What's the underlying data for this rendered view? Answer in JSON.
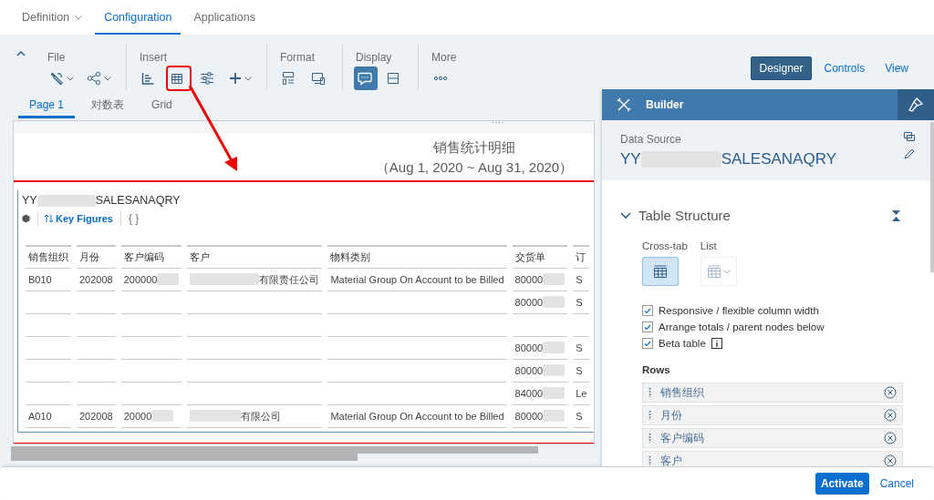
{
  "top_tabs": [
    {
      "label": "Definition",
      "selected": false,
      "menu": true
    },
    {
      "label": "Configuration",
      "selected": true,
      "menu": false
    },
    {
      "label": "Applications",
      "selected": false,
      "menu": false
    }
  ],
  "toolbar": {
    "groups": [
      {
        "label": "File",
        "tools": [
          {
            "kind": "wrench",
            "menu": true,
            "active": false,
            "annotated": false
          },
          {
            "kind": "share",
            "menu": true,
            "active": false,
            "annotated": false
          }
        ]
      },
      {
        "label": "Insert",
        "tools": [
          {
            "kind": "chart",
            "menu": false,
            "active": false,
            "annotated": false
          },
          {
            "kind": "table",
            "menu": false,
            "active": false,
            "annotated": true
          },
          {
            "kind": "sliders",
            "menu": false,
            "active": false,
            "annotated": false
          },
          {
            "kind": "plus",
            "menu": true,
            "active": false,
            "annotated": false
          }
        ]
      },
      {
        "label": "Format",
        "tools": [
          {
            "kind": "form",
            "menu": false,
            "active": false,
            "annotated": false
          },
          {
            "kind": "devices",
            "menu": false,
            "active": false,
            "annotated": false
          }
        ]
      },
      {
        "label": "Display",
        "tools": [
          {
            "kind": "comment",
            "menu": false,
            "active": true,
            "annotated": false
          },
          {
            "kind": "panels",
            "menu": false,
            "active": false,
            "annotated": false
          }
        ]
      },
      {
        "label": "More",
        "tools": [
          {
            "kind": "dots",
            "menu": false,
            "active": false,
            "annotated": false
          }
        ]
      }
    ]
  },
  "view_switch": [
    {
      "label": "Designer",
      "selected": true
    },
    {
      "label": "Controls",
      "selected": false
    },
    {
      "label": "View",
      "selected": false
    }
  ],
  "page_tabs": [
    {
      "label": "Page 1",
      "selected": true
    },
    {
      "label": "对数表",
      "selected": false
    },
    {
      "label": "Grid",
      "selected": false
    }
  ],
  "report": {
    "title": "销售统计明细",
    "subtitle": "（Aug 1, 2020 ~ Aug 31, 2020）"
  },
  "annotation": {
    "arrow": true
  },
  "table_widget": {
    "annotated": true,
    "name_start": "YY",
    "name_end": "SALESANAQRY",
    "key_figures": "Key Figures",
    "braces": "{ }",
    "columns": [
      "销售组织",
      "月份",
      "客户编码",
      "客户",
      "物料类别",
      "交货单",
      "订"
    ],
    "rows": [
      {
        "cells": [
          {
            "text": "B010"
          },
          {
            "text": "202008"
          },
          {
            "text": "200000",
            "blur_after": true
          },
          {
            "text": "有限责任公司",
            "blur_before": true
          },
          {
            "text": "Material Group On Account to be Billed"
          },
          {
            "text": "80000",
            "blur_after": true
          },
          {
            "text": "S"
          }
        ]
      },
      {
        "cells": [
          null,
          null,
          null,
          null,
          null,
          {
            "text": "80000",
            "blur_after": true
          },
          {
            "text": "S"
          }
        ]
      },
      {
        "cells": [
          null,
          null,
          null,
          null,
          null,
          null,
          null
        ]
      },
      {
        "cells": [
          null,
          null,
          null,
          null,
          null,
          {
            "text": "80000",
            "blur_after": true
          },
          {
            "text": "S"
          }
        ]
      },
      {
        "cells": [
          null,
          null,
          null,
          null,
          null,
          {
            "text": "80000",
            "blur_after": true
          },
          {
            "text": "S"
          }
        ]
      },
      {
        "cells": [
          null,
          null,
          null,
          null,
          null,
          {
            "text": "84000",
            "blur_after": true
          },
          {
            "text": "Le"
          }
        ]
      },
      {
        "cells": [
          {
            "text": "A010"
          },
          {
            "text": "202008"
          },
          {
            "text": "20000",
            "blur_after": true
          },
          {
            "text": "有限公司",
            "blur_before": true
          },
          {
            "text": "Material Group On Account to be Billed"
          },
          {
            "text": "80000",
            "blur_after": true
          },
          {
            "text": "S"
          }
        ]
      }
    ]
  },
  "builder": {
    "title": "Builder",
    "data_source_label": "Data Source",
    "data_source_start": "YY",
    "data_source_end": "SALESANAQRY",
    "section": {
      "title": "Table Structure",
      "expanded": true
    },
    "layouts": [
      {
        "label": "Cross-tab",
        "selected": true,
        "menu": false
      },
      {
        "label": "List",
        "selected": false,
        "menu": true
      }
    ],
    "options": [
      {
        "label": "Responsive / flexible column width",
        "checked": true,
        "info": false
      },
      {
        "label": "Arrange totals / parent nodes below",
        "checked": true,
        "info": false
      },
      {
        "label": "Beta table",
        "checked": true,
        "info": true
      }
    ],
    "rows_label": "Rows",
    "row_fields": [
      "销售组织",
      "月份",
      "客户编码",
      "客户"
    ]
  },
  "footer": {
    "buttons": [
      {
        "label": "Activate",
        "kind": "primary"
      },
      {
        "label": "Cancel",
        "kind": "link"
      }
    ]
  }
}
